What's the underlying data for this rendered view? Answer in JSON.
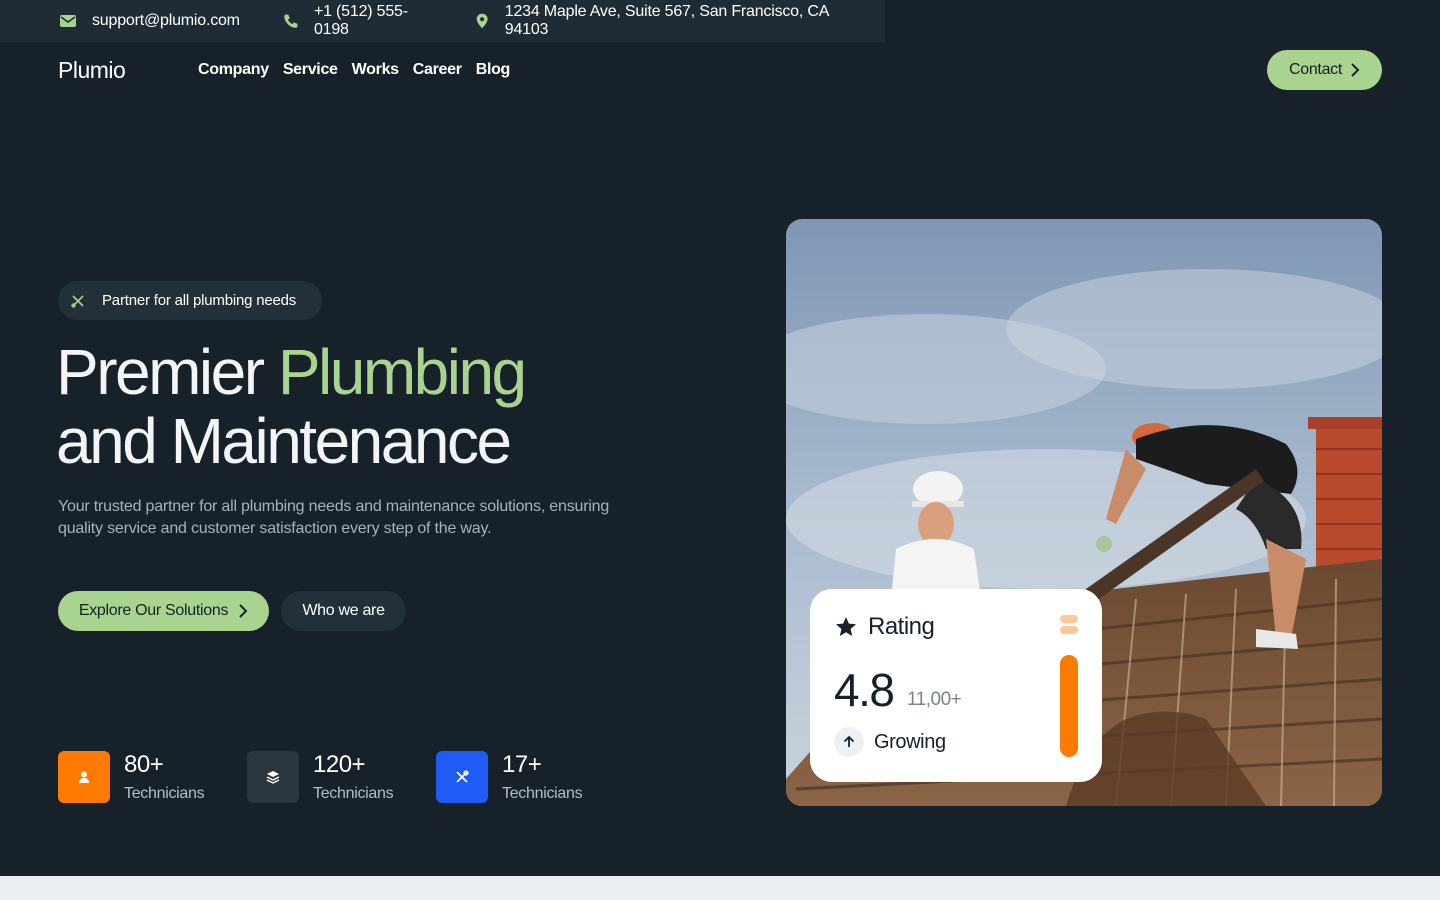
{
  "topbar": {
    "email": "support@plumio.com",
    "phone": "+1 (512) 555-0198",
    "address": "1234 Maple Ave, Suite 567, San Francisco, CA 94103"
  },
  "nav": {
    "logo": "Plumio",
    "items": [
      "Company",
      "Service",
      "Works",
      "Career",
      "Blog"
    ],
    "contact_label": "Contact"
  },
  "hero": {
    "badge": "Partner for all plumbing needs",
    "headline_part1": "Premier ",
    "headline_highlight": "Plumbing",
    "headline_part2": "and Maintenance",
    "description": "Your trusted partner for all plumbing needs and maintenance solutions, ensuring quality service and customer satisfaction every step of the way.",
    "primary_cta": "Explore Our Solutions",
    "secondary_cta": "Who we are"
  },
  "stats": [
    {
      "value": "80+",
      "label": "Technicians",
      "icon": "user-icon",
      "color": "#ff7a00"
    },
    {
      "value": "120+",
      "label": "Technicians",
      "icon": "layers-icon",
      "color": "#2b363f"
    },
    {
      "value": "17+",
      "label": "Technicians",
      "icon": "tools-icon",
      "color": "#1f5cf5"
    }
  ],
  "rating": {
    "title": "Rating",
    "value": "4.8",
    "count": "11,00+",
    "trend": "Growing",
    "gauge_fill": 0.85
  },
  "colors": {
    "background": "#16212a",
    "accent": "#a8d48f",
    "orange": "#ff7a00",
    "blue": "#1f5cf5"
  }
}
